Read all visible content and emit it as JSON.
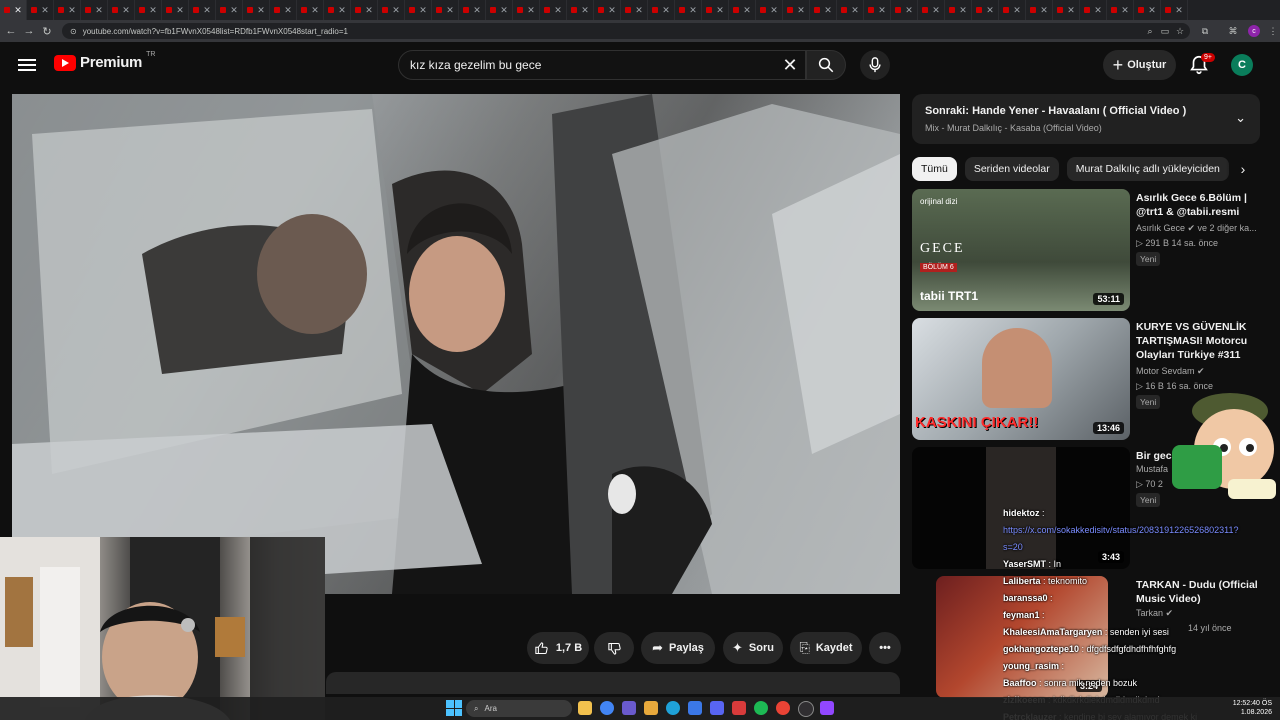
{
  "browser": {
    "url": "youtube.com/watch?v=fb1FWvnX0548list=RDfb1FWvnX0548start_radio=1",
    "tab_count": 44,
    "tab_close": "✕",
    "profile_initial": "c"
  },
  "header": {
    "logo_text": "Premium",
    "region": "TR",
    "search_value": "kız kıza gezelim bu gece",
    "create_label": "Oluştur",
    "notif_count": "9+",
    "avatar_initial": "C"
  },
  "actions": {
    "like_count": "1,7 B",
    "share_label": "Paylaş",
    "ask_label": "Soru",
    "save_label": "Kaydet"
  },
  "sidebar": {
    "next_title": "Sonraki: Hande Yener - Havaalanı ( Official Video )",
    "next_sub": "Mix - Murat Dalkılıç - Kasaba (Official Video)",
    "chips": [
      "Tümü",
      "Seriden videolar",
      "Murat Dalkılıç adlı yükleyiciden"
    ],
    "videos": [
      {
        "title": "Asırlık Gece 6.Bölüm | @trt1 & @tabii.resmi",
        "channel": "Asırlık Gece ✔ ve 2 diğer ka...",
        "meta": "▷ 291 B  14 sa. önce",
        "badge": "Yeni",
        "duration": "53:11",
        "thumb_text": "GECE",
        "thumb_badge": "BÖLÜM 6",
        "thumb_top": "orijinal dizi",
        "thumb_brand": "tabii  TRT1"
      },
      {
        "title": "KURYE VS GÜVENLİK TARTIŞMASI! Motorcu Olayları Türkiye #311",
        "channel": "Motor Sevdam ✔",
        "meta": "▷ 16 B  16 sa. önce",
        "badge": "Yeni",
        "duration": "13:46",
        "thumb_text": "KASKINI ÇIKAR!!"
      },
      {
        "title": "Bir gec",
        "channel": "Mustafa",
        "meta": "▷ 70  2",
        "badge": "Yeni",
        "duration": "3:43"
      },
      {
        "title": "TARKAN - Dudu (Official Music Video)",
        "channel": "Tarkan ✔",
        "meta": "14 yıl önce",
        "badge": "",
        "duration": "3:24"
      }
    ]
  },
  "chat": [
    {
      "user": "hidektoz",
      "text": " :"
    },
    {
      "user": "",
      "text": "https://x.com/sokakkedisitv/status/2083191226526802311?",
      "link": true
    },
    {
      "user": "",
      "text": "s=20",
      "link": true
    },
    {
      "user": "YaserSMT",
      "text": " :  In"
    },
    {
      "user": "Laliberta",
      "text": " : teknomito"
    },
    {
      "user": "baranssa0",
      "text": " :"
    },
    {
      "user": "feyman1",
      "text": " :"
    },
    {
      "user": "KhaleesiAmaTargaryen",
      "text": " : senden iyi sesi"
    },
    {
      "user": "gokhangoztepe10",
      "text": " : dfgdfsdfgfdhdfhfhfghfg"
    },
    {
      "user": "young_rasim",
      "text": " :"
    },
    {
      "user": "Baaffoo",
      "text": " : sonra mik neden bozuk"
    },
    {
      "user": "zizikoeem",
      "text": " : kdkdkrkdlekdmdldmdkdmd"
    },
    {
      "user": "Petrcklauzer",
      "text": " : kendine bi şey alamıyor demek ki"
    }
  ],
  "taskbar": {
    "search_label": "Ara",
    "time": "12:52:40 ÖS",
    "date": "1.08.2026"
  },
  "colors": {
    "brand": "#ff0000",
    "background": "#0f0f0f",
    "chip": "#272727",
    "link": "#7a8cff"
  }
}
